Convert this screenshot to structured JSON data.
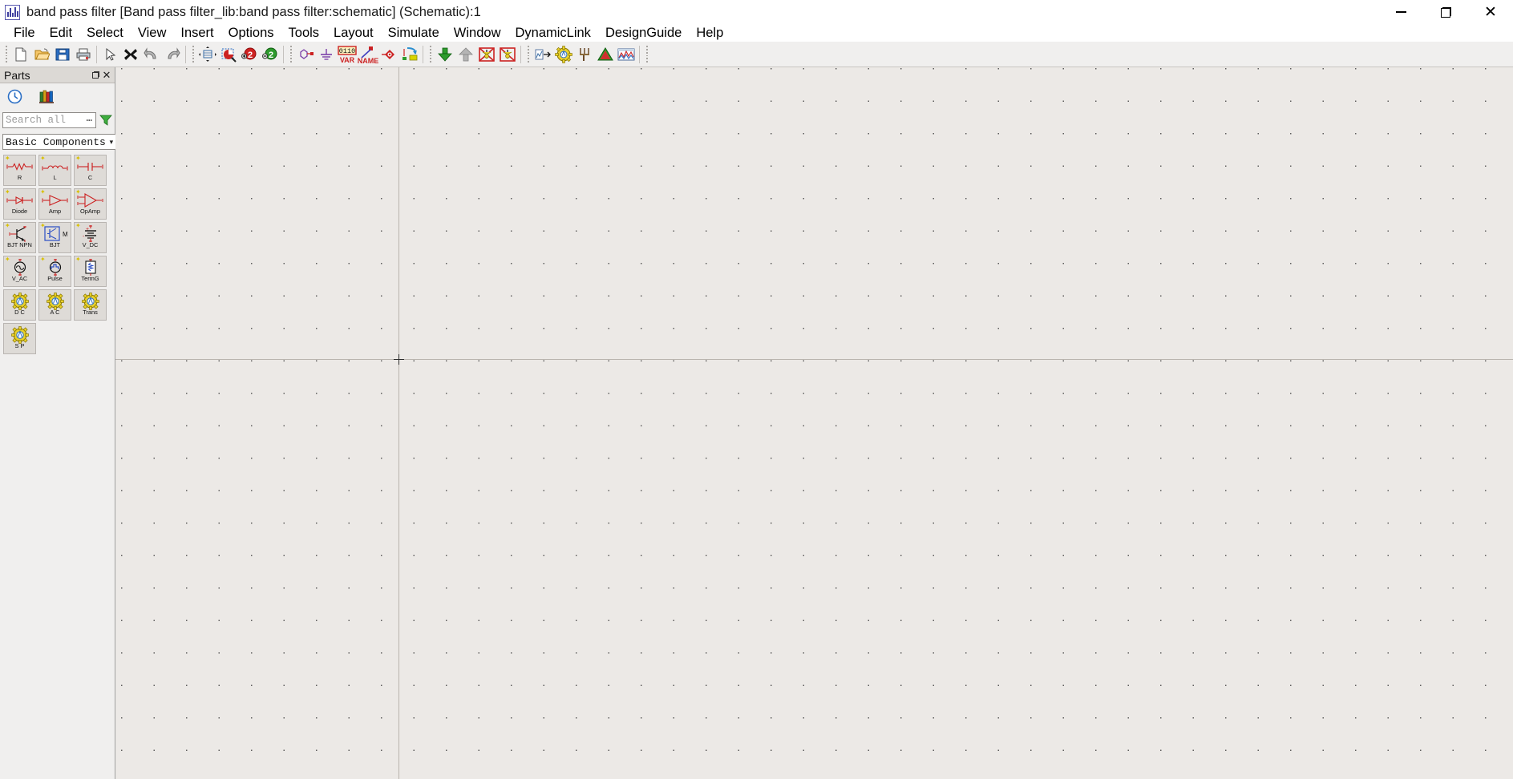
{
  "window": {
    "app_icon": "schematic-waveform-icon",
    "title": "band pass filter [Band pass filter_lib:band pass filter:schematic] (Schematic):1",
    "controls": {
      "minimize": "minimize-icon",
      "maximize": "restore-icon",
      "close": "close-icon"
    }
  },
  "menubar": {
    "items": [
      {
        "label": "File"
      },
      {
        "label": "Edit"
      },
      {
        "label": "Select"
      },
      {
        "label": "View"
      },
      {
        "label": "Insert"
      },
      {
        "label": "Options"
      },
      {
        "label": "Tools"
      },
      {
        "label": "Layout"
      },
      {
        "label": "Simulate"
      },
      {
        "label": "Window"
      },
      {
        "label": "DynamicLink"
      },
      {
        "label": "DesignGuide"
      },
      {
        "label": "Help"
      }
    ]
  },
  "toolbar": {
    "groups": [
      {
        "buttons": [
          {
            "name": "new-icon",
            "title": "New"
          },
          {
            "name": "open-folder-icon",
            "title": "Open"
          },
          {
            "name": "save-icon",
            "title": "Save"
          },
          {
            "name": "print-icon",
            "title": "Print"
          }
        ]
      },
      {
        "buttons": [
          {
            "name": "select-arrow-icon",
            "title": "Select"
          },
          {
            "name": "delete-x-icon",
            "title": "Delete"
          },
          {
            "name": "undo-icon",
            "title": "Undo"
          },
          {
            "name": "redo-icon",
            "title": "Redo"
          }
        ]
      },
      {
        "buttons": [
          {
            "name": "view-all-icon",
            "title": "View All"
          },
          {
            "name": "zoom-area-icon",
            "title": "Zoom Area"
          },
          {
            "name": "zoom-in-icon",
            "title": "Zoom In"
          },
          {
            "name": "zoom-out-icon",
            "title": "Zoom Out"
          }
        ]
      },
      {
        "buttons": [
          {
            "name": "insert-wire-icon",
            "title": "Insert Wire"
          },
          {
            "name": "insert-ground-icon",
            "title": "Insert GROUND"
          },
          {
            "name": "insert-var-icon",
            "title": "Insert VAR",
            "label": "0110",
            "sublabel": "VAR"
          },
          {
            "name": "wire-label-icon",
            "title": "Wire/Pin Label",
            "label": "NAME"
          },
          {
            "name": "insert-port-icon",
            "title": "Insert Port"
          },
          {
            "name": "component-update-icon",
            "title": "Component Update"
          }
        ]
      },
      {
        "buttons": [
          {
            "name": "push-into-hierarchy-icon",
            "title": "Push Into Hierarchy"
          },
          {
            "name": "pop-out-hierarchy-icon",
            "title": "Pop Out"
          },
          {
            "name": "deactivate-component-icon",
            "title": "Deactivate Component"
          },
          {
            "name": "activate-component-icon",
            "title": "Activate Component"
          }
        ]
      },
      {
        "buttons": [
          {
            "name": "tune-parameters-icon",
            "title": "Tune Parameters"
          },
          {
            "name": "simulation-settings-icon",
            "title": "Simulation Settings"
          },
          {
            "name": "tuning-fork-icon",
            "title": "Tuning"
          },
          {
            "name": "simulate-icon",
            "title": "Simulate"
          },
          {
            "name": "data-display-icon",
            "title": "New Data Display"
          }
        ]
      }
    ]
  },
  "parts_panel": {
    "title": "Parts",
    "header_buttons": {
      "float": "float-panel-icon",
      "close": "close-panel-icon"
    },
    "toolbar": [
      {
        "name": "history-clock-icon",
        "title": "History"
      },
      {
        "name": "library-books-icon",
        "title": "Library"
      }
    ],
    "search": {
      "placeholder": "Search all",
      "value": "",
      "ellipsis": "⋯",
      "filter_icon": "funnel-filter-icon"
    },
    "category": {
      "selected": "Basic Components",
      "arrow_icon": "chevron-down-icon"
    },
    "components": [
      {
        "label": "R",
        "sym": "resistor",
        "starred": true
      },
      {
        "label": "L",
        "sym": "inductor",
        "starred": true
      },
      {
        "label": "C",
        "sym": "capacitor",
        "starred": true
      },
      {
        "label": "Diode",
        "sym": "diode",
        "starred": true
      },
      {
        "label": "Amp",
        "sym": "amplifier",
        "starred": true
      },
      {
        "label": "OpAmp",
        "sym": "opamp",
        "starred": true
      },
      {
        "label": "BJT NPN",
        "sym": "bjt-npn",
        "starred": true
      },
      {
        "label": "BJT",
        "sym": "bjt-model",
        "starred": true
      },
      {
        "label": "V_DC",
        "sym": "vdc-source",
        "starred": true
      },
      {
        "label": "V_AC",
        "sym": "vac-source",
        "starred": true
      },
      {
        "label": "Pulse",
        "sym": "pulse-source",
        "starred": true
      },
      {
        "label": "TermG",
        "sym": "term-ground",
        "starred": true
      },
      {
        "label": "D C",
        "sym": "dc-sim-gear",
        "starred": false
      },
      {
        "label": "A C",
        "sym": "ac-sim-gear",
        "starred": false
      },
      {
        "label": "Trans",
        "sym": "trans-sim-gear",
        "starred": false
      },
      {
        "label": "S P",
        "sym": "sp-sim-gear",
        "starred": false
      }
    ]
  },
  "canvas": {
    "name": "schematic-canvas",
    "background_color": "#ece9e6",
    "grid": {
      "visible": true,
      "dot_spacing_px": 40,
      "dot_color": "#5a5a5a"
    },
    "origin_marker": "origin-crosshair",
    "axis_color": "#b9b4ae"
  }
}
